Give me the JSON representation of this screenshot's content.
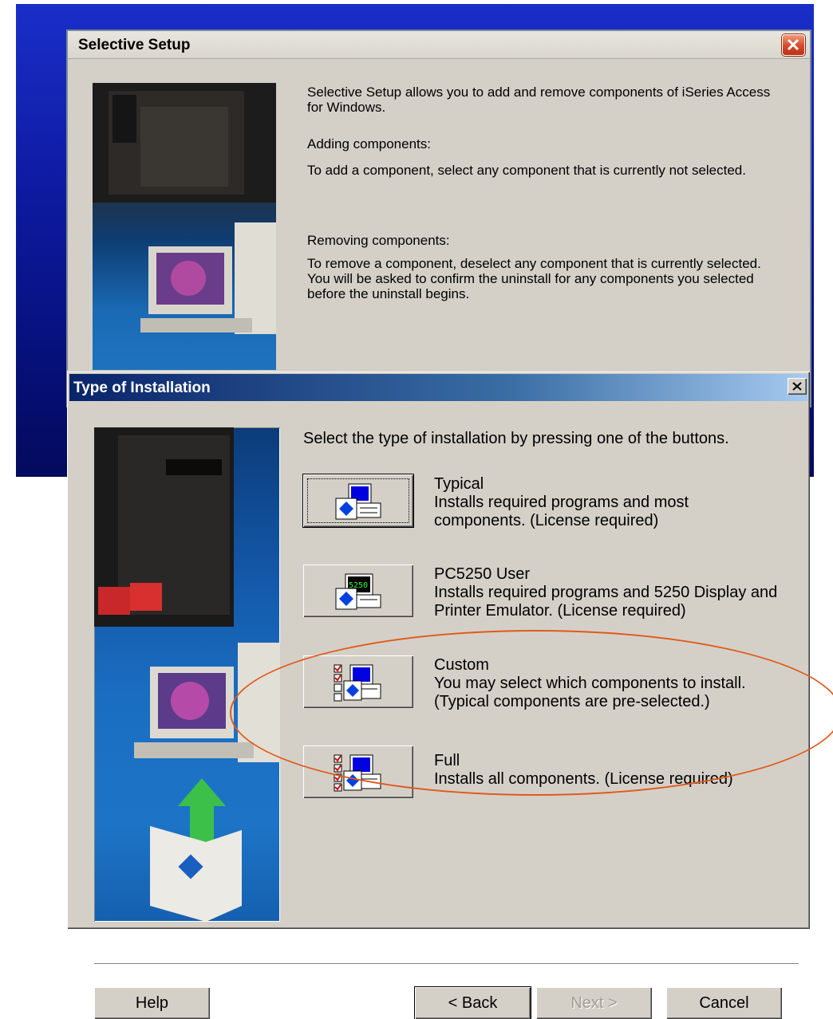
{
  "selective_setup": {
    "title": "Selective Setup",
    "intro": "Selective Setup allows you to add and remove components of iSeries Access for Windows.",
    "adding_heading": "Adding components:",
    "adding_text": "To add a component, select any component that is currently not selected.",
    "removing_heading": "Removing components:",
    "removing_text": "To remove a component, deselect any component that is currently selected.  You will be asked to confirm the uninstall for any components you selected before the uninstall begins."
  },
  "type_of_installation": {
    "title": "Type of Installation",
    "intro": "Select the type of installation by pressing one of the buttons.",
    "options": [
      {
        "name": "Typical",
        "description": "Installs required programs and most components.  (License required)",
        "icon": "typical-install-icon"
      },
      {
        "name": "PC5250 User",
        "description": "Installs required programs and 5250 Display and Printer Emulator.  (License required)",
        "icon": "pc5250-install-icon"
      },
      {
        "name": "Custom",
        "description": "You may select which components to install. (Typical components are pre-selected.)",
        "icon": "custom-install-icon"
      },
      {
        "name": "Full",
        "description": "Installs all components.  (License required)",
        "icon": "full-install-icon"
      }
    ],
    "buttons": {
      "help": "Help",
      "back": "< Back",
      "next": "Next >",
      "cancel": "Cancel"
    },
    "monitor_label": "5250"
  },
  "colors": {
    "annotation": "#e05a1c",
    "titlebar": "#0a246a",
    "dialog_face": "#d4d0c8"
  }
}
